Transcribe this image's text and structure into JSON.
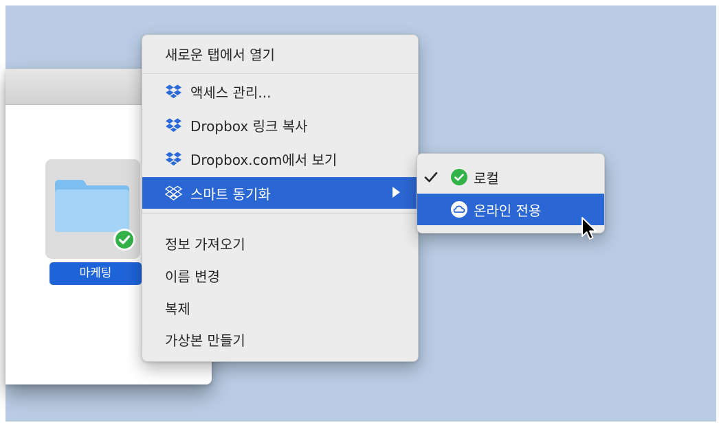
{
  "finder": {
    "folder_label": "마케팅"
  },
  "context_menu": {
    "items": [
      {
        "label": "새로운 탭에서 열기"
      },
      {
        "label": "액세스 관리...",
        "icon": "dropbox-icon"
      },
      {
        "label": "Dropbox 링크 복사",
        "icon": "dropbox-icon"
      },
      {
        "label": "Dropbox.com에서 보기",
        "icon": "dropbox-icon"
      },
      {
        "label": "스마트 동기화",
        "icon": "smart-sync-icon",
        "highlighted": true,
        "has_submenu": true
      },
      {
        "label": "정보 가져오기"
      },
      {
        "label": "이름 변경"
      },
      {
        "label": "복제"
      },
      {
        "label": "가상본 만들기"
      }
    ]
  },
  "submenu": {
    "items": [
      {
        "label": "로컬",
        "checked": true,
        "icon": "green-check-icon"
      },
      {
        "label": "온라인 전용",
        "highlighted": true,
        "icon": "cloud-icon"
      }
    ]
  },
  "colors": {
    "desktop": "#b9cce4",
    "highlight": "#2b67d4",
    "sync_green": "#34b24a",
    "dropbox_blue": "#2a6ad9"
  }
}
